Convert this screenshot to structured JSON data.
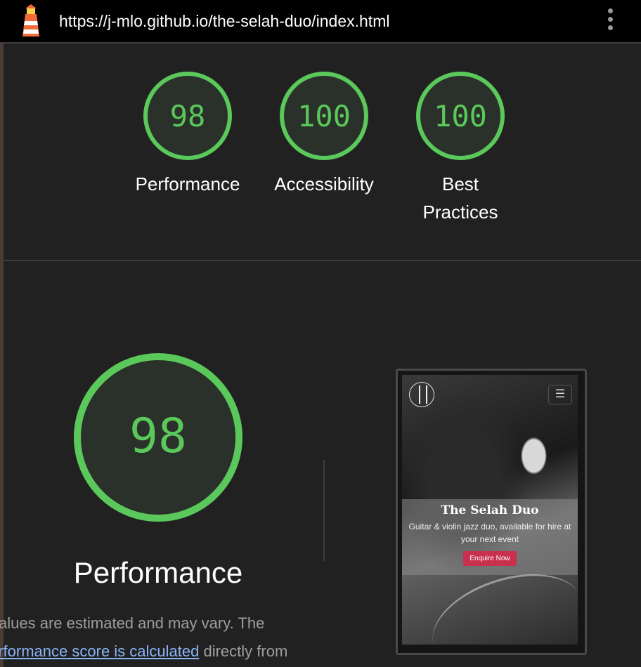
{
  "header": {
    "url": "https://j-mlo.github.io/the-selah-duo/index.html",
    "logo_icon": "lighthouse-icon",
    "menu_icon": "kebab-menu-icon"
  },
  "gauges": [
    {
      "score": "98",
      "label": "Performance"
    },
    {
      "score": "100",
      "label": "Accessibility"
    },
    {
      "score": "100",
      "label": "Best Practices"
    }
  ],
  "performance": {
    "score": "98",
    "label": "Performance",
    "desc_before": "Values are estimated and may vary. The ",
    "desc_link": "erformance score is calculated",
    "desc_after": " directly from"
  },
  "screenshot": {
    "title": "The Selah Duo",
    "subtitle": "Guitar & violin jazz duo, available for hire at your next event",
    "button": "Enquire Now",
    "menu_icon": "hamburger-icon",
    "logo_icon": "selah-logo-icon"
  },
  "colors": {
    "pass": "#5ac85a",
    "pass_fill": "#2a312a",
    "link": "#8ab4f8",
    "button": "#c9304e"
  }
}
